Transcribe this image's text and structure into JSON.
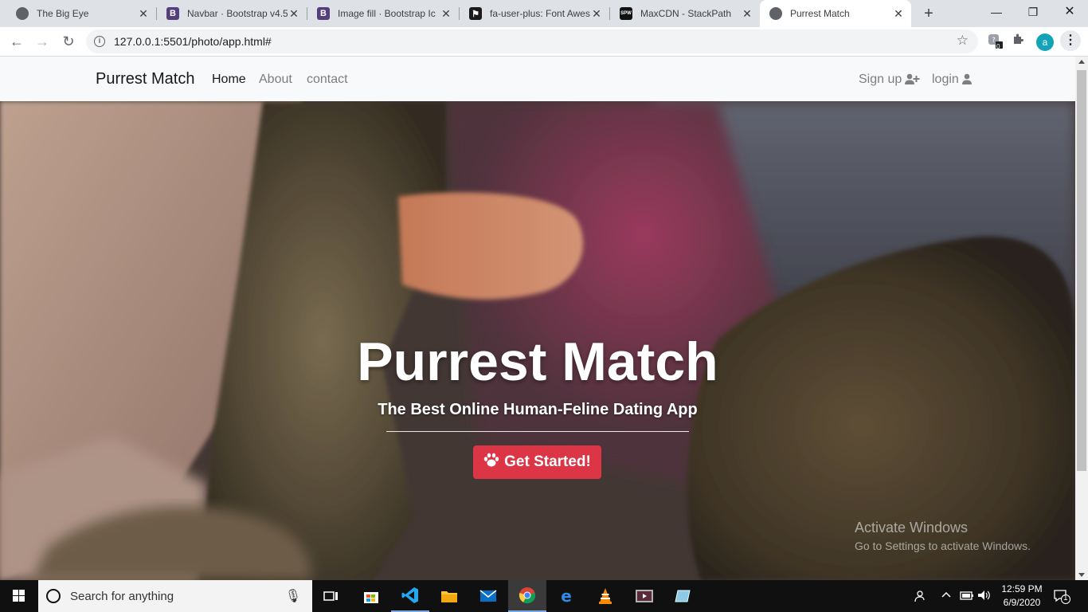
{
  "browser": {
    "tabs": [
      {
        "title": "The Big Eye",
        "icon": "globe-icon"
      },
      {
        "title": "Navbar · Bootstrap v4.5",
        "icon": "bootstrap-icon"
      },
      {
        "title": "Image fill · Bootstrap Ic",
        "icon": "bootstrap-icon"
      },
      {
        "title": "fa-user-plus: Font Awes",
        "icon": "flag-icon"
      },
      {
        "title": "MaxCDN - StackPath",
        "icon": "stackpath-icon"
      },
      {
        "title": "Purrest Match",
        "icon": "globe-icon",
        "active": true
      }
    ],
    "url": "127.0.0.1:5501/photo/app.html#",
    "profile_initial": "a",
    "extension_badge": "0"
  },
  "navbar": {
    "brand": "Purrest Match",
    "links": [
      {
        "label": "Home",
        "active": true
      },
      {
        "label": "About"
      },
      {
        "label": "contact"
      }
    ],
    "signup_label": "Sign up",
    "login_label": "login"
  },
  "hero": {
    "title": "Purrest Match",
    "subtitle": "The Best Online Human-Feline Dating App",
    "cta_label": "Get Started!",
    "cta_color": "#dc3545"
  },
  "watermark": {
    "line1": "Activate Windows",
    "line2": "Go to Settings to activate Windows."
  },
  "taskbar": {
    "search_placeholder": "Search for anything",
    "time": "12:59 PM",
    "date": "6/9/2020",
    "notification_count": "1"
  }
}
